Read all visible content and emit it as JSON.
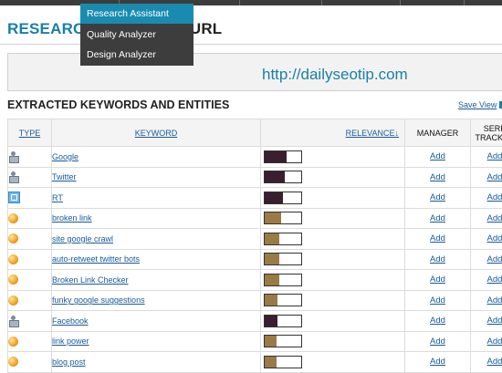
{
  "page": {
    "title_prefix": "RESEARCH",
    "title_suffix": "/ URL",
    "url": "http://dailyseotip.com"
  },
  "menu": {
    "items": [
      {
        "label": "Research Assistant",
        "active": true
      },
      {
        "label": "Quality Analyzer",
        "active": false
      },
      {
        "label": "Design Analyzer",
        "active": false
      }
    ]
  },
  "section": {
    "title": "EXTRACTED KEYWORDS AND ENTITIES",
    "save_link": "Save View"
  },
  "table": {
    "headers": {
      "type": "TYPE",
      "keyword": "KEYWORD",
      "relevance": "RELEVANCE↓",
      "manager": "MANAGER",
      "serp_line1": "SERP",
      "serp_line2": "TRACKER"
    },
    "rows": [
      {
        "type_icon": "person-icon",
        "keyword": "Google",
        "relevance": 0.6,
        "bar_color": "#3a1f30",
        "manager": "Add",
        "serp": "Add"
      },
      {
        "type_icon": "person-icon",
        "keyword": "Twitter",
        "relevance": 0.55,
        "bar_color": "#3a1f30",
        "manager": "Add",
        "serp": "Add"
      },
      {
        "type_icon": "retweet-icon",
        "keyword": "RT",
        "relevance": 0.5,
        "bar_color": "#3a1f30",
        "manager": "Add",
        "serp": "Add"
      },
      {
        "type_icon": "keyword-ball-icon",
        "keyword": "broken link",
        "relevance": 0.45,
        "bar_color": "#9a7a45",
        "manager": "Add",
        "serp": "Add"
      },
      {
        "type_icon": "keyword-ball-icon",
        "keyword": "site google crawl",
        "relevance": 0.4,
        "bar_color": "#9a7a45",
        "manager": "Add",
        "serp": "Add"
      },
      {
        "type_icon": "keyword-ball-icon",
        "keyword": "auto-retweet twitter bots",
        "relevance": 0.4,
        "bar_color": "#9a7a45",
        "manager": "Add",
        "serp": "Add"
      },
      {
        "type_icon": "keyword-ball-icon",
        "keyword": "Broken Link Checker",
        "relevance": 0.4,
        "bar_color": "#9a7a45",
        "manager": "Add",
        "serp": "Add"
      },
      {
        "type_icon": "keyword-ball-icon",
        "keyword": "funky google suggestions",
        "relevance": 0.35,
        "bar_color": "#9a7a45",
        "manager": "Add",
        "serp": "Add"
      },
      {
        "type_icon": "person-icon",
        "keyword": "Facebook",
        "relevance": 0.35,
        "bar_color": "#3a1f30",
        "manager": "Add",
        "serp": "Add"
      },
      {
        "type_icon": "keyword-ball-icon",
        "keyword": "link power",
        "relevance": 0.33,
        "bar_color": "#9a7a45",
        "manager": "Add",
        "serp": "Add"
      },
      {
        "type_icon": "keyword-ball-icon",
        "keyword": "blog post",
        "relevance": 0.33,
        "bar_color": "#9a7a45",
        "manager": "Add",
        "serp": "Add"
      }
    ]
  }
}
